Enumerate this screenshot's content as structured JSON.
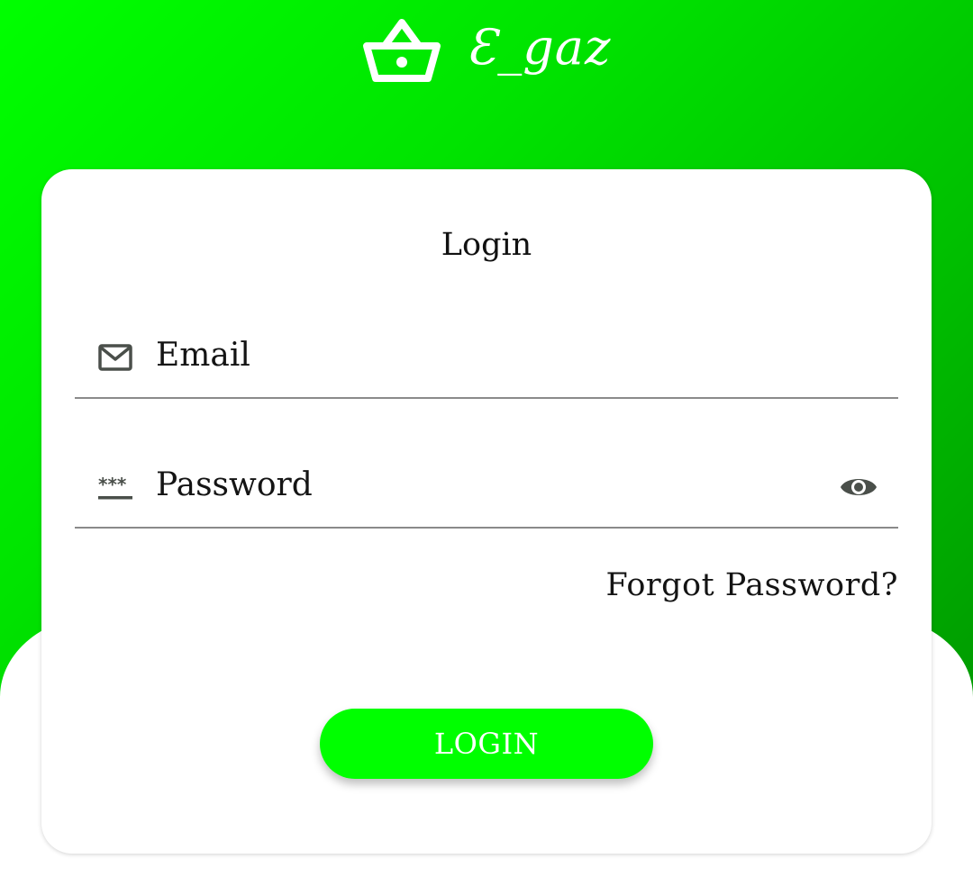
{
  "brand": {
    "name": "Ɛ_gaz",
    "icon": "basket-icon"
  },
  "login_card": {
    "title": "Login",
    "email_field": {
      "placeholder": "Email",
      "icon": "mail-icon"
    },
    "password_field": {
      "placeholder": "Password",
      "icon": "password-icon",
      "toggle_icon": "eye-icon"
    },
    "forgot_password_label": "Forgot Password?",
    "login_button_label": "LOGIN"
  },
  "colors": {
    "accent": "#00ff00",
    "gradient_dark": "#009a00",
    "text": "#141414",
    "icon": "#4a4f4a"
  }
}
